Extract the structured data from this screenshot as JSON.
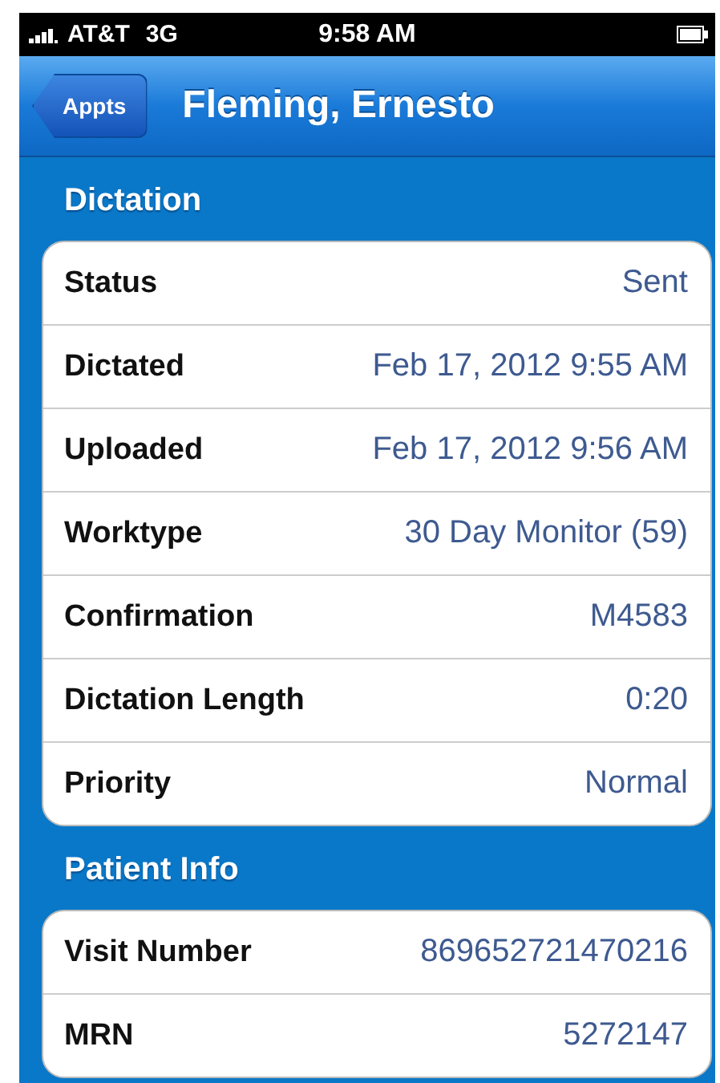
{
  "status_bar": {
    "carrier": "AT&T",
    "network": "3G",
    "time": "9:58 AM"
  },
  "nav_bar": {
    "back_button": "Appts",
    "title": "Fleming, Ernesto"
  },
  "sections": [
    {
      "title": "Dictation",
      "rows": [
        {
          "label": "Status",
          "value": "Sent"
        },
        {
          "label": "Dictated",
          "value": "Feb 17, 2012 9:55 AM"
        },
        {
          "label": "Uploaded",
          "value": "Feb 17, 2012 9:56 AM"
        },
        {
          "label": "Worktype",
          "value": "30 Day Monitor (59)"
        },
        {
          "label": "Confirmation",
          "value": "M4583"
        },
        {
          "label": "Dictation Length",
          "value": "0:20"
        },
        {
          "label": "Priority",
          "value": "Normal"
        }
      ]
    },
    {
      "title": "Patient Info",
      "rows": [
        {
          "label": "Visit Number",
          "value": "869652721470216"
        },
        {
          "label": "MRN",
          "value": "5272147"
        }
      ]
    }
  ]
}
